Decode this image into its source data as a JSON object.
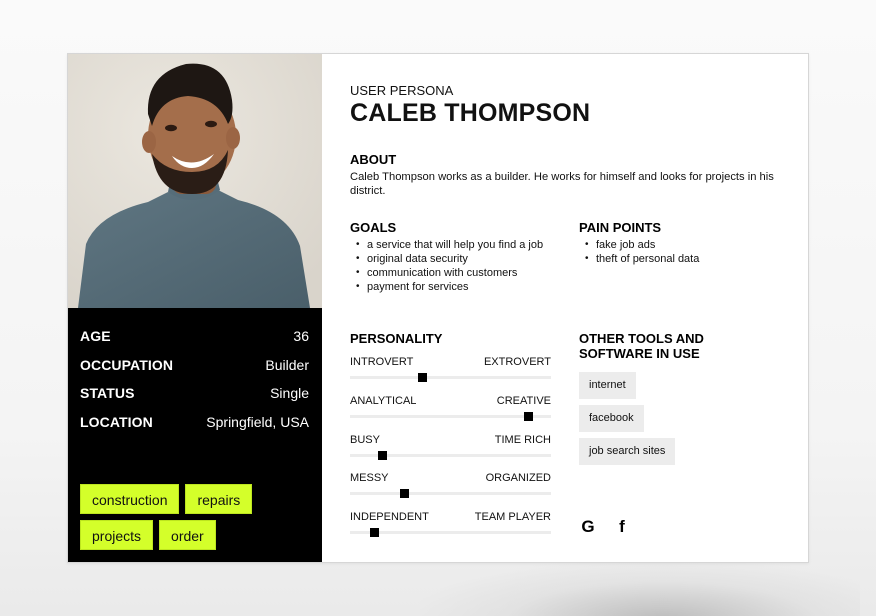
{
  "persona": {
    "eyebrow": "USER PERSONA",
    "name": "CALEB THOMPSON",
    "photo_alt": "Portrait of a smiling bearded man in a grey knit sweater"
  },
  "facts": [
    {
      "label": "AGE",
      "value": "36"
    },
    {
      "label": "OCCUPATION",
      "value": "Builder"
    },
    {
      "label": "STATUS",
      "value": "Single"
    },
    {
      "label": "LOCATION",
      "value": "Springfield, USA"
    }
  ],
  "tags": [
    "construction",
    "repairs",
    "projects",
    "order"
  ],
  "about": {
    "heading": "ABOUT",
    "text": "Caleb Thompson works as a builder. He works for himself and looks for projects in his district."
  },
  "goals": {
    "heading": "GOALS",
    "items": [
      "a service that will help you find a job",
      "original data security",
      "communication with customers",
      "payment for services"
    ]
  },
  "pain_points": {
    "heading": "PAIN POINTS",
    "items": [
      "fake job ads",
      "theft of personal data"
    ]
  },
  "personality": {
    "heading": "PERSONALITY",
    "traits": [
      {
        "left": "INTROVERT",
        "right": "EXTROVERT",
        "value": 0.36
      },
      {
        "left": "ANALYTICAL",
        "right": "CREATIVE",
        "value": 0.89
      },
      {
        "left": "BUSY",
        "right": "TIME RICH",
        "value": 0.16
      },
      {
        "left": "MESSY",
        "right": "ORGANIZED",
        "value": 0.27
      },
      {
        "left": "INDEPENDENT",
        "right": "TEAM PLAYER",
        "value": 0.12
      }
    ]
  },
  "tools": {
    "heading": "OTHER TOOLS AND SOFTWARE IN USE",
    "items": [
      "internet",
      "facebook",
      "job search sites"
    ]
  },
  "social_icons": [
    {
      "name": "google-icon",
      "glyph": "G"
    },
    {
      "name": "facebook-icon",
      "glyph": "f"
    }
  ],
  "colors": {
    "tag_accent": "#d4ff2a",
    "panel_dark": "#000000",
    "tool_chip": "#ececec"
  }
}
